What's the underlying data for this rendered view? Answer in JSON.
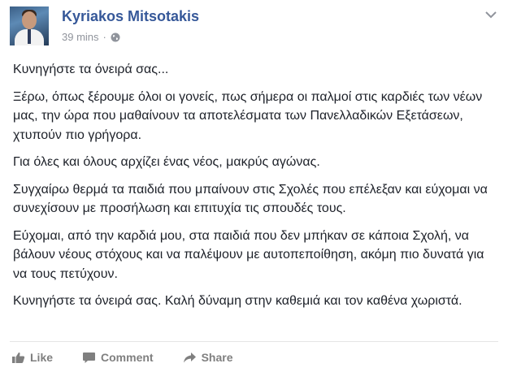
{
  "post": {
    "author": "Kyriakos Mitsotakis",
    "time": "39 mins",
    "separator": "·",
    "paragraphs": [
      "Κυνηγήστε τα όνειρά σας...",
      "Ξέρω, όπως ξέρουμε όλοι οι γονείς, πως σήμερα οι παλμοί στις καρδιές των νέων μας, την ώρα που μαθαίνουν τα αποτελέσματα των Πανελλαδικών Εξετάσεων, χτυπούν πιο γρήγορα.",
      "Για όλες και όλους αρχίζει ένας νέος, μακρύς αγώνας.",
      "Συγχαίρω θερμά τα παιδιά που μπαίνουν στις Σχολές που επέλεξαν και εύχομαι να συνεχίσουν με προσήλωση και επιτυχία τις σπουδές τους.",
      "Εύχομαι, από την καρδιά μου, στα παιδιά που δεν μπήκαν σε κάποια Σχολή, να βάλουν νέους στόχους και να παλέψουν με αυτοπεποίθηση, ακόμη πιο δυνατά για να τους πετύχουν.",
      "Κυνηγήστε τα όνειρά σας. Καλή δύναμη στην καθεμιά και τον καθένα χωριστά."
    ]
  },
  "actions": {
    "like": "Like",
    "comment": "Comment",
    "share": "Share"
  },
  "icons": {
    "audience": "globe-icon",
    "options": "chevron-down-icon",
    "like": "thumbs-up-icon",
    "comment": "comment-bubble-icon",
    "share": "share-arrow-icon"
  },
  "colors": {
    "author_link": "#365899",
    "meta_text": "#90949c",
    "action_text": "#7f7f7f"
  }
}
